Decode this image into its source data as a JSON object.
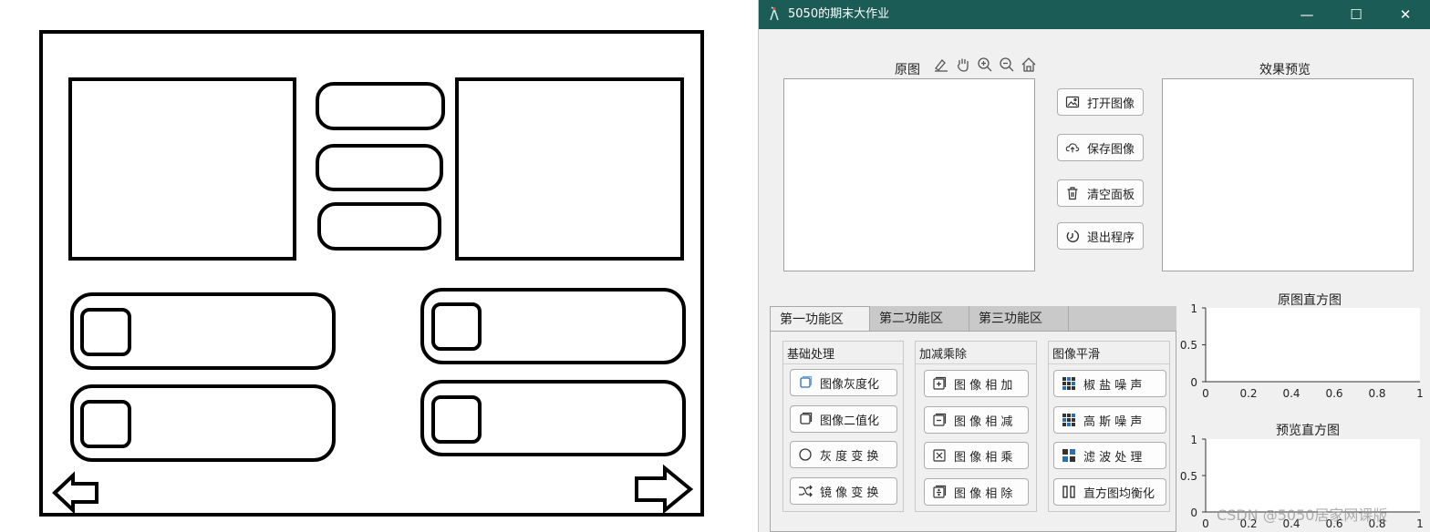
{
  "window": {
    "title": "5050的期末大作业",
    "min_glyph": "—",
    "max_glyph": "☐",
    "close_glyph": "✕"
  },
  "original_panel": {
    "title": "原图"
  },
  "preview_panel": {
    "title": "效果预览"
  },
  "main_buttons": [
    {
      "label": "打开图像",
      "icon": "image-icon"
    },
    {
      "label": "保存图像",
      "icon": "cloud-upload-icon"
    },
    {
      "label": "清空面板",
      "icon": "trash-icon"
    },
    {
      "label": "退出程序",
      "icon": "exit-icon"
    }
  ],
  "tabs": [
    {
      "label": "第一功能区",
      "active": true
    },
    {
      "label": "第二功能区",
      "active": false
    },
    {
      "label": "第三功能区",
      "active": false
    }
  ],
  "groups": [
    {
      "title": "基础处理",
      "buttons": [
        "图像灰度化",
        "图像二值化",
        "灰 度 变 换",
        "镜 像 变 换"
      ]
    },
    {
      "title": "加减乘除",
      "buttons": [
        "图 像 相 加",
        "图 像 相 减",
        "图 像 相 乘",
        "图 像 相 除"
      ]
    },
    {
      "title": "图像平滑",
      "buttons": [
        "椒 盐 噪 声",
        "高 斯 噪 声",
        "滤 波 处 理",
        "直方图均衡化"
      ]
    }
  ],
  "histograms": [
    {
      "title": "原图直方图",
      "yticks": [
        "1",
        "0.5",
        "0"
      ],
      "xticks": [
        "0",
        "0.2",
        "0.4",
        "0.6",
        "0.8",
        "1"
      ]
    },
    {
      "title": "预览直方图",
      "yticks": [
        "1",
        "0.5",
        "0"
      ],
      "xticks": [
        "0",
        "0.2",
        "0.4",
        "0.6",
        "0.8",
        "1"
      ]
    }
  ],
  "watermark": "CSDN @5050居家网课版",
  "colors": {
    "titlebar": "#1b5c56",
    "accent": "#2a6fb8"
  }
}
